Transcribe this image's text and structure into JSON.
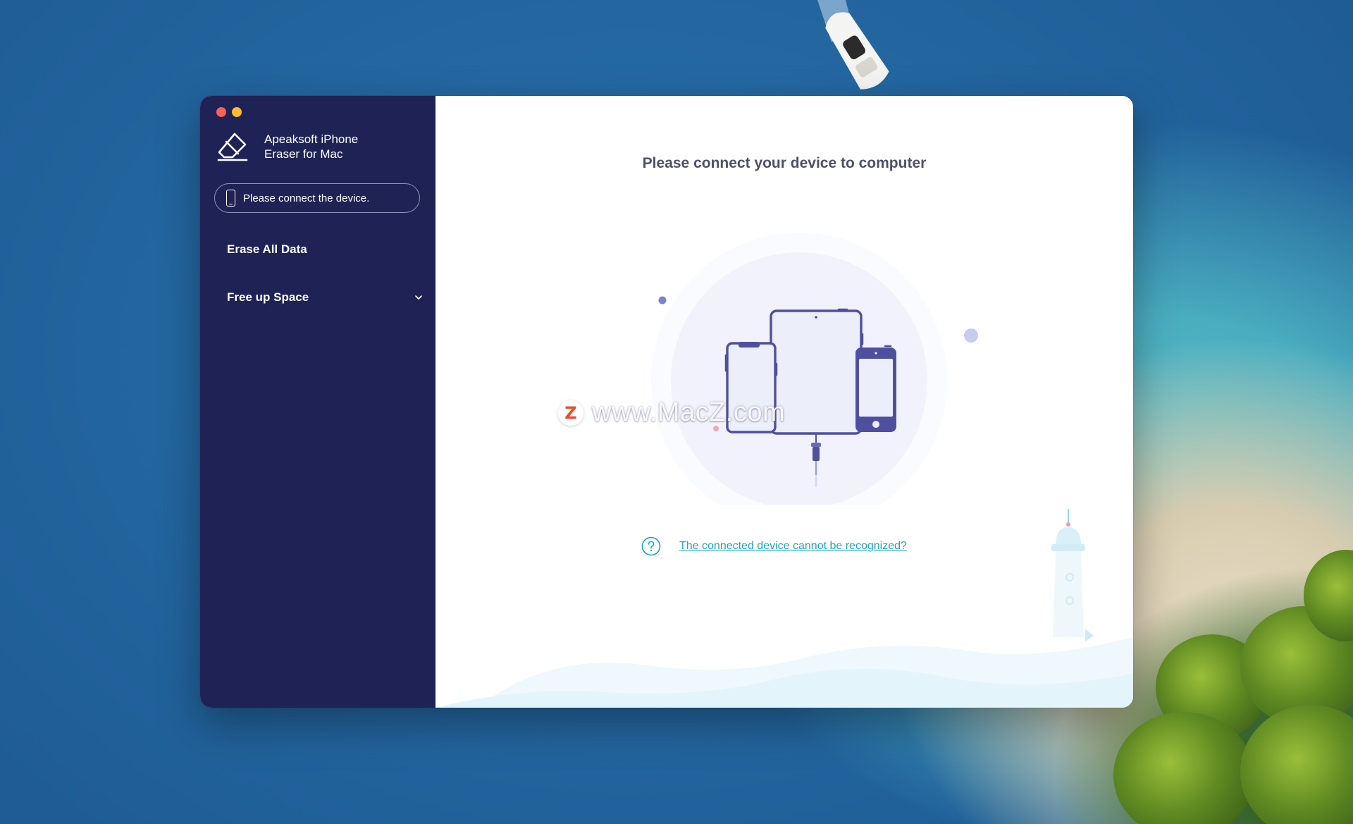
{
  "app": {
    "name": "Apeaksoft iPhone Eraser for Mac"
  },
  "sidebar": {
    "device_status": "Please connect the device.",
    "items": [
      {
        "label": "Erase All Data"
      },
      {
        "label": "Free up Space"
      }
    ]
  },
  "main": {
    "title": "Please connect your device to computer",
    "help_link": "The connected device cannot be recognized?"
  },
  "watermark": {
    "badge": "Z",
    "text": "www.MacZ.com"
  },
  "colors": {
    "sidebar_bg": "#1f2254",
    "accent_link": "#1aa6c3",
    "device_purple": "#4f4f9f",
    "title_gray": "#4d5167"
  },
  "icons": {
    "logo": "eraser-icon",
    "device": "phone-icon",
    "expand": "chevron-down-icon",
    "help": "question-circle-icon"
  }
}
